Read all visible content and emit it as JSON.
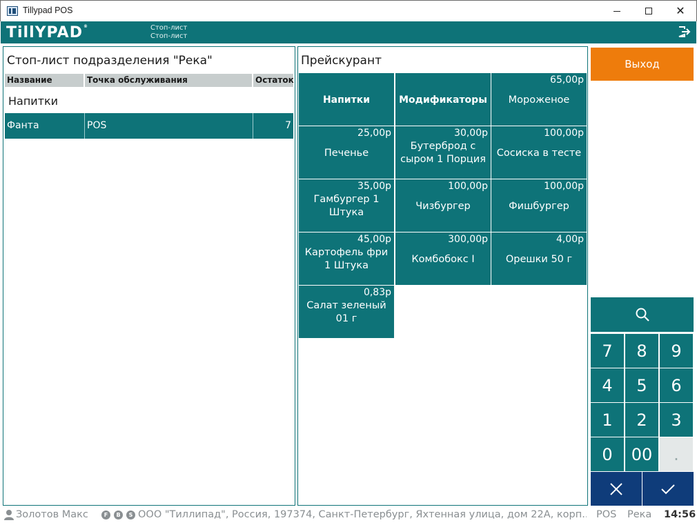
{
  "window": {
    "title": "Tillypad POS"
  },
  "header": {
    "logo": "TillYPAD",
    "breadcrumb_top": "Стоп-лист",
    "breadcrumb_bottom": "Стоп-лист"
  },
  "stoplist": {
    "title": "Стоп-лист подразделения \"Река\"",
    "columns": [
      "Название",
      "Точка обслуживания",
      "Остаток"
    ],
    "group": "Напитки",
    "rows": [
      {
        "name": "Фанта",
        "point": "POS",
        "remainder": "7"
      }
    ]
  },
  "pricelist": {
    "title": "Прейскурант",
    "tiles": [
      {
        "name": "Напитки",
        "price": ""
      },
      {
        "name": "Модификаторы",
        "price": ""
      },
      {
        "name": "Мороженое",
        "price": "65,00р"
      },
      {
        "name": "Печенье",
        "price": "25,00р"
      },
      {
        "name": "Бутерброд с сыром 1 Порция",
        "price": "30,00р"
      },
      {
        "name": "Сосиска в тесте",
        "price": "100,00р"
      },
      {
        "name": "Гамбургер 1 Штука",
        "price": "35,00р"
      },
      {
        "name": "Чизбургер",
        "price": "100,00р"
      },
      {
        "name": "Фишбургер",
        "price": "100,00р"
      },
      {
        "name": "Картофель фри 1 Штука",
        "price": "45,00р"
      },
      {
        "name": "Комбобокс I",
        "price": "300,00р"
      },
      {
        "name": "Орешки 50 г",
        "price": "4,00р"
      },
      {
        "name": "Салат зеленый 01 г",
        "price": "0,83р"
      }
    ]
  },
  "actions": {
    "exit_label": "Выход"
  },
  "keypad": {
    "keys": [
      "7",
      "8",
      "9",
      "4",
      "5",
      "6",
      "1",
      "2",
      "3",
      "0",
      "00",
      "."
    ]
  },
  "statusbar": {
    "user": "Золотов Макс",
    "badges": [
      "F",
      "B",
      "S"
    ],
    "org": "ООО \"Тиллипад\", Россия, 197374, Санкт-Петербург, Яхтенная улица, дом 22А, корп...",
    "pos": "POS",
    "dept": "Река",
    "time": "14:56"
  },
  "colors": {
    "teal": "#0e7378",
    "orange": "#ee7c0c",
    "navy": "#0f3c7a"
  }
}
